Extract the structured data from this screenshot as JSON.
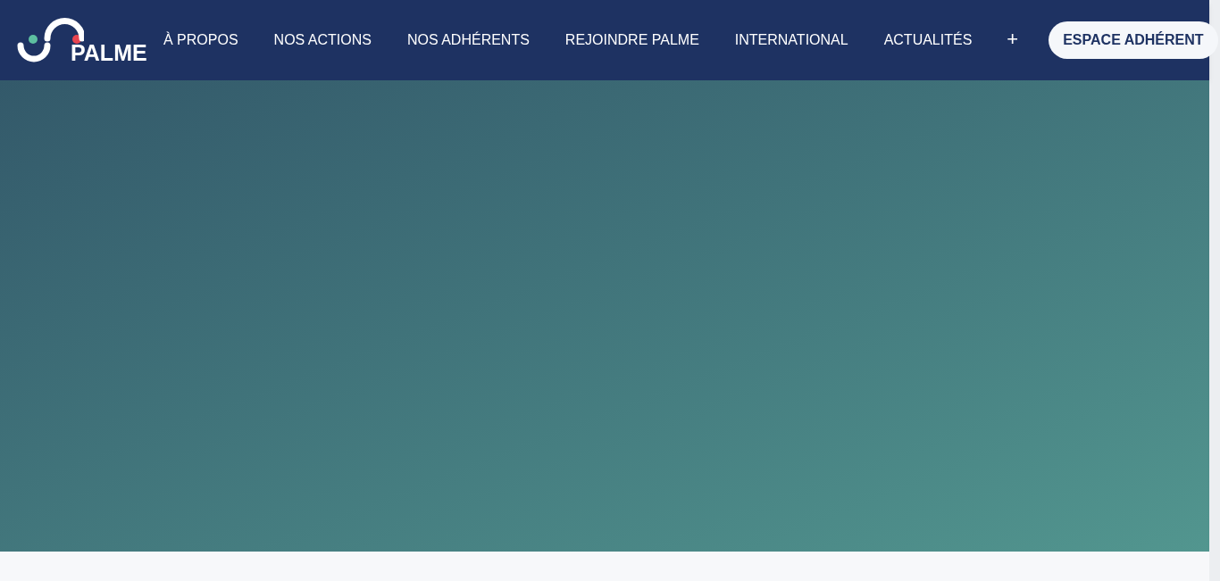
{
  "logo": {
    "text": "PALME"
  },
  "nav": {
    "items": [
      {
        "label": "À PROPOS"
      },
      {
        "label": "NOS ACTIONS"
      },
      {
        "label": "NOS ADHÉRENTS"
      },
      {
        "label": "REJOINDRE PALME"
      },
      {
        "label": "INTERNATIONAL"
      },
      {
        "label": "ACTUALITÉS"
      }
    ],
    "more": "+",
    "cta": "ESPACE ADHÉRENT"
  }
}
